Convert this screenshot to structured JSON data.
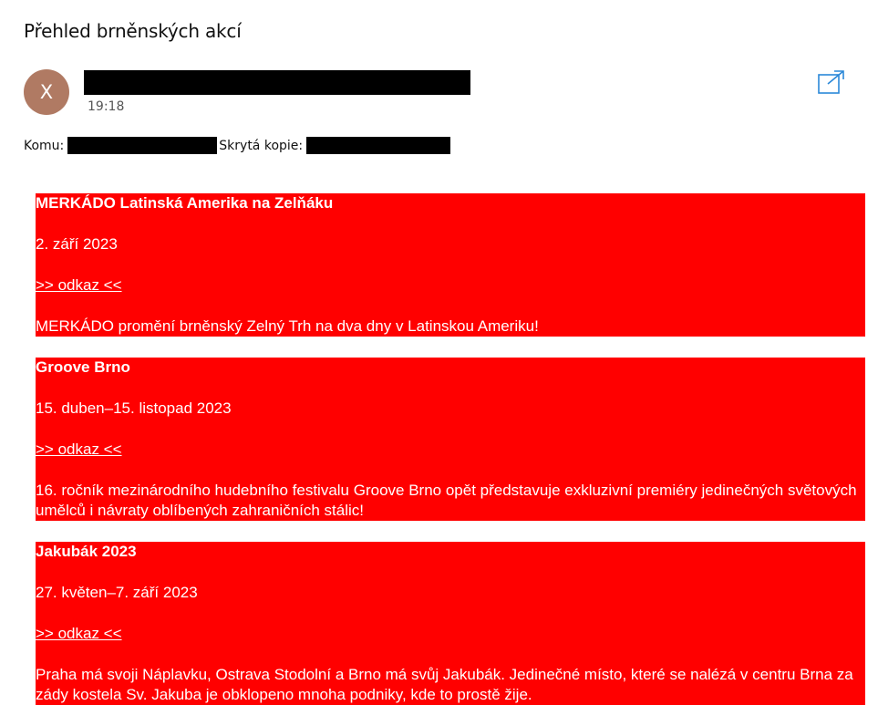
{
  "subject": "Přehled brněnských akcí",
  "sender": {
    "avatar_initial": "X",
    "time": "19:18",
    "name_redacted": true
  },
  "recipients": {
    "to_label": "Komu:",
    "bcc_label": "Skrytá kopie:"
  },
  "icons": {
    "popout": "open-in-new-window-icon"
  },
  "colors": {
    "event_background": "#ff0000",
    "event_text": "#ffffff",
    "avatar": "#b07a63",
    "accent": "#2b88d8"
  },
  "events": [
    {
      "title": "MERKÁDO Latinská Amerika na Zelňáku",
      "date": "2. září 2023",
      "link": ">> odkaz <<",
      "description": "MERKÁDO promění brněnský Zelný Trh na dva dny v Latinskou Ameriku!"
    },
    {
      "title": "Groove Brno",
      "date": "15. duben–15. listopad 2023",
      "link": ">> odkaz <<",
      "description": "16. ročník mezinárodního hudebního festivalu Groove Brno opět představuje exkluzivní premiéry jedinečných světových umělců i návraty oblíbených zahraničních stálic!"
    },
    {
      "title": "Jakubák 2023",
      "date": "27. květen–7. září 2023",
      "link": ">> odkaz <<",
      "description": "Praha má svoji Náplavku, Ostrava Stodolní a Brno má svůj Jakubák. Jedinečné místo, které se nalézá v centru Brna za zády kostela Sv. Jakuba je obklopeno mnoha podniky, kde to prostě žije."
    }
  ]
}
